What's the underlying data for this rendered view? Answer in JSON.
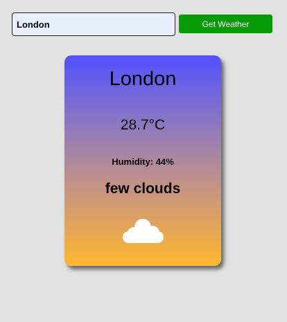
{
  "search": {
    "value": "London",
    "button_label": "Get Weather"
  },
  "weather": {
    "city": "London",
    "temperature": "28.7°C",
    "humidity_label": "Humidity: ",
    "humidity_value": "44",
    "humidity_unit": "%",
    "description": "few clouds",
    "icon": "cloud-icon"
  },
  "colors": {
    "button": "#079a07",
    "card_top": "#5151ff",
    "card_bottom": "#ffb62e",
    "background": "#e2e2e2"
  }
}
